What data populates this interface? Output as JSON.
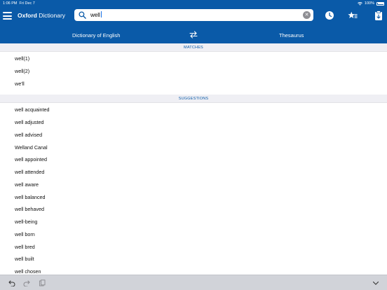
{
  "status_bar": {
    "time": "1:06 PM",
    "date": "Fri Dec 7",
    "battery": "100%"
  },
  "header": {
    "app_title_bold": "Oxford",
    "app_title_rest": " Dictionary",
    "search_value": "well",
    "icons": [
      "menu-icon",
      "search-icon",
      "clear-icon",
      "history-icon",
      "favorites-icon",
      "clipboard-icon"
    ]
  },
  "tabs": {
    "left": "Dictionary of English",
    "right": "Thesaurus"
  },
  "sections": {
    "matches": "MATCHES",
    "suggestions": "SUGGESTIONS"
  },
  "matches": [
    "well(1)",
    "well(2)",
    "we'll"
  ],
  "suggestions": [
    "well acquainted",
    "well adjusted",
    "well advised",
    "Welland Canal",
    "well appointed",
    "well attended",
    "well aware",
    "well balanced",
    "well behaved",
    "well-being",
    "well born",
    "well bred",
    "well built",
    "well chosen"
  ],
  "colors": {
    "brand_blue": "#0a5aa8",
    "section_bg": "#efeff4",
    "toolbar_bg": "#d1d3d9"
  }
}
